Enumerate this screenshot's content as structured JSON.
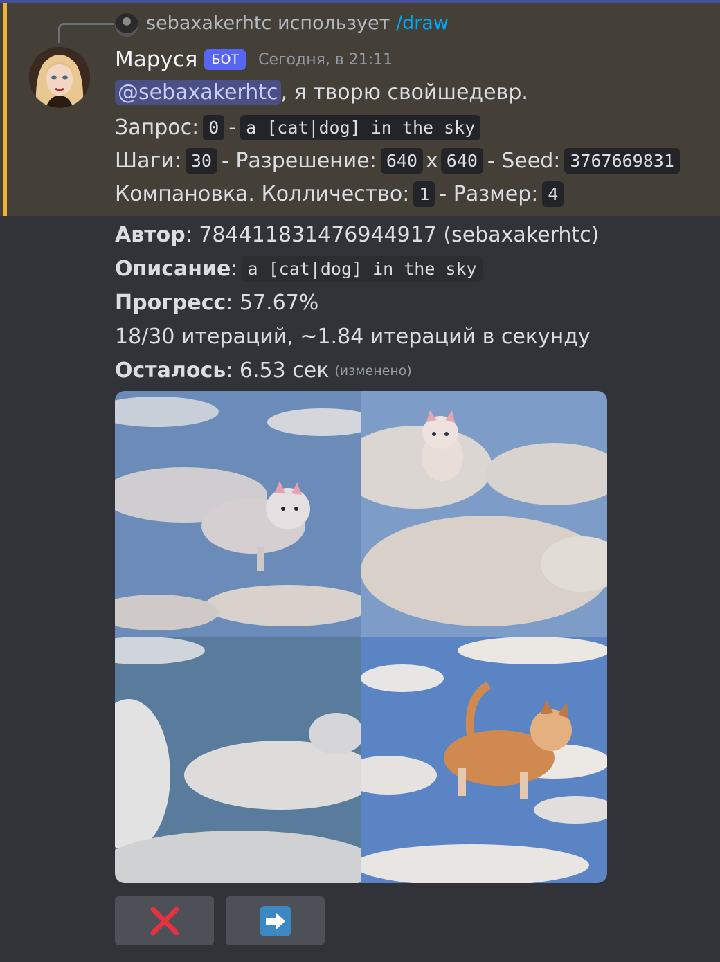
{
  "reply": {
    "user": "sebaxakerhtc",
    "action": "использует",
    "command": "/draw"
  },
  "message": {
    "author": "Маруся",
    "bot_tag": "БОТ",
    "timestamp": "Сегодня, в 21:11",
    "mention": "@sebaxakerhtc",
    "intro_text": ", я творю свойшедевр.",
    "request_label": "Запрос:",
    "request_index": "0",
    "request_sep": "-",
    "request_prompt": "a [cat|dog] in the sky",
    "steps_label": "Шаги:",
    "steps_value": "30",
    "resolution_label": "- Разрешение:",
    "resolution_w": "640",
    "resolution_x": "x",
    "resolution_h": "640",
    "seed_label": "- Seed:",
    "seed_value": "3767669831",
    "layout_label": "Компановка. Колличество:",
    "count_value": "1",
    "size_label": "- Размер:",
    "size_value": "4"
  },
  "status": {
    "author_label": "Автор",
    "author_value": ": 784411831476944917 (sebaxakerhtc)",
    "description_label": "Описание",
    "description_colon": ":",
    "description_value": "a [cat|dog] in the sky",
    "progress_label": "Прогресс",
    "progress_value": ": 57.67%",
    "progress_fraction": 0.5767,
    "iterations_text": "18/30 итераций, ~1.84 итераций в секунду",
    "remaining_label": "Осталось",
    "remaining_value": ": 6.53 сек",
    "edited_text": "(изменено)"
  },
  "buttons": {
    "cancel_icon": "red-x-icon",
    "next_icon": "right-arrow-icon"
  },
  "colors": {
    "background": "#313338",
    "highlight": "#444038",
    "highlight_bar": "#f0b232",
    "bot_tag": "#5865f2",
    "link": "#00a8fc",
    "mention_bg": "#4a4f86"
  }
}
